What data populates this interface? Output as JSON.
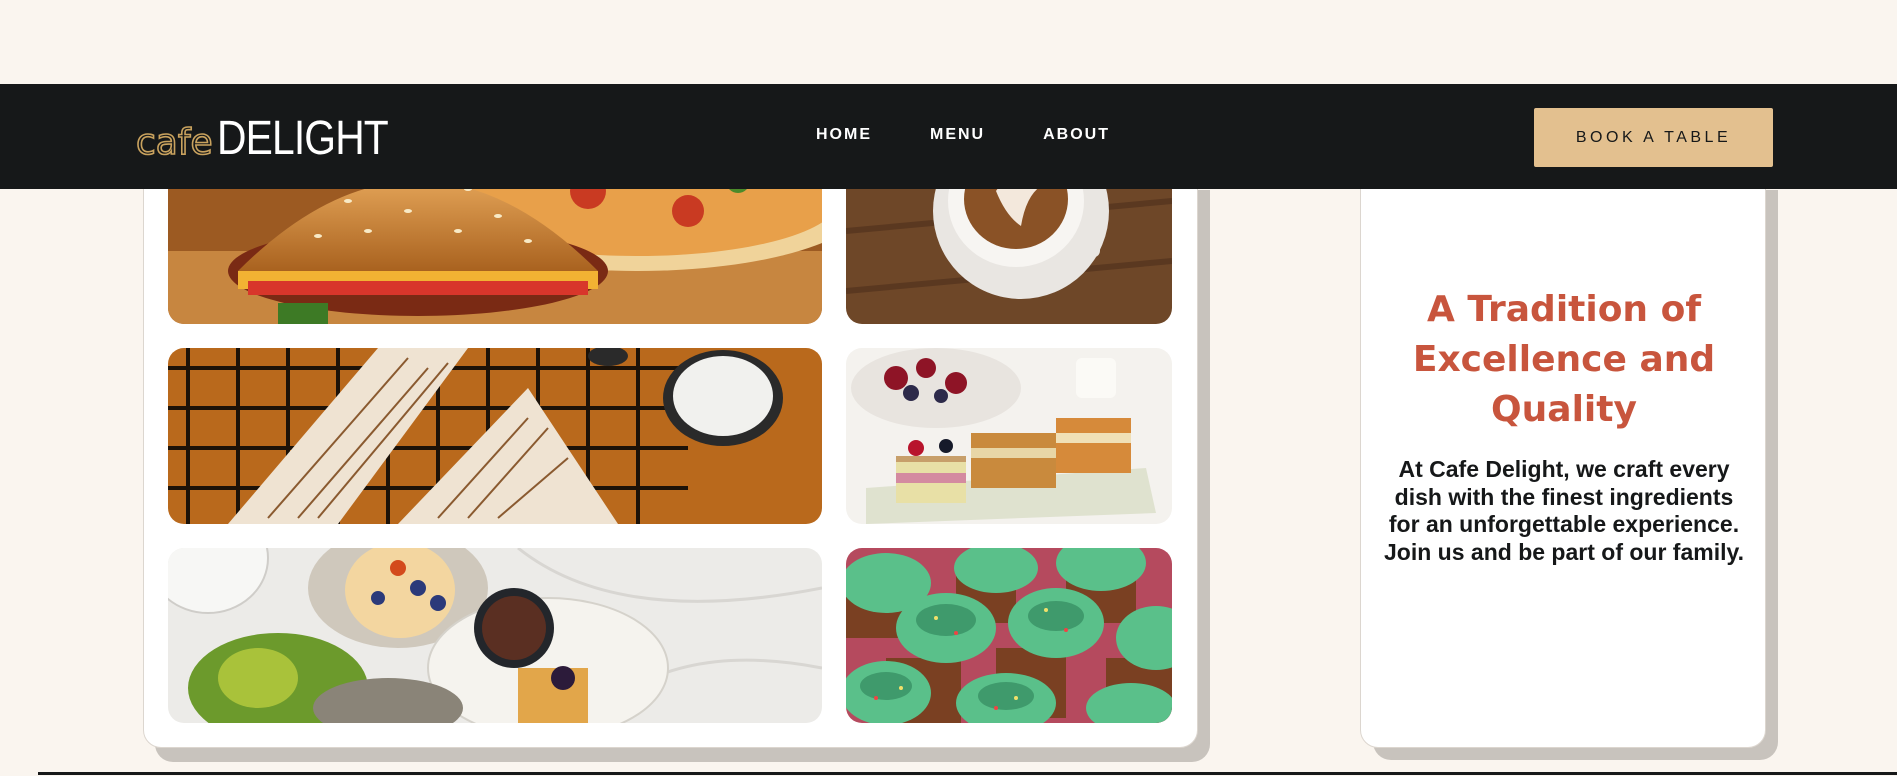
{
  "nav": {
    "logo_cafe": "cafe",
    "logo_delight": "DELIGHT",
    "links": [
      "HOME",
      "MENU",
      "ABOUT"
    ],
    "cta": "BOOK A TABLE"
  },
  "gallery": {
    "images": [
      "burger-and-pizza",
      "latte-art-coffee",
      "grilled-wraps-with-dip",
      "layered-cakes-and-berries",
      "breakfast-spread",
      "green-frosted-cupcakes"
    ]
  },
  "about": {
    "title": "A Tradition of Excellence and Quality",
    "text": "At Cafe Delight, we craft every dish with the finest ingredients for an unforgettable experience. Join us and be part of our family."
  },
  "colors": {
    "page_bg": "#faf5ef",
    "navbar_bg": "#161819",
    "accent_gold": "#e3c08f",
    "title_red": "#c8553d"
  }
}
